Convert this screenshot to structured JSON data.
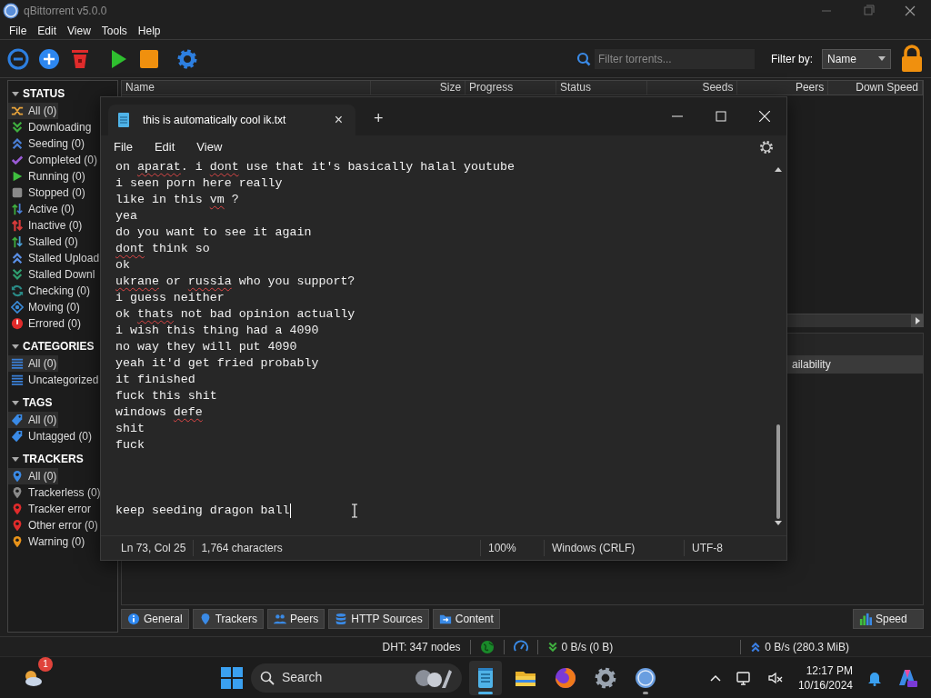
{
  "qbittorrent": {
    "title": "qBittorrent v5.0.0",
    "menu": [
      "File",
      "Edit",
      "View",
      "Tools",
      "Help"
    ],
    "search": {
      "placeholder": "Filter torrents..."
    },
    "filter_label": "Filter by:",
    "filter_value": "Name",
    "columns": [
      "Name",
      "Size",
      "Progress",
      "Status",
      "Seeds",
      "Peers",
      "Down Speed"
    ],
    "properties_header": "ailability",
    "sidebar": [
      {
        "title": "STATUS",
        "items": [
          {
            "label": "All (0)",
            "selected": true
          },
          {
            "label": "Downloading",
            "selected": false
          },
          {
            "label": "Seeding (0)",
            "selected": false
          },
          {
            "label": "Completed (0)",
            "selected": false
          },
          {
            "label": "Running (0)",
            "selected": false
          },
          {
            "label": "Stopped (0)",
            "selected": false
          },
          {
            "label": "Active (0)",
            "selected": false
          },
          {
            "label": "Inactive (0)",
            "selected": false
          },
          {
            "label": "Stalled (0)",
            "selected": false
          },
          {
            "label": "Stalled Upload",
            "selected": false
          },
          {
            "label": "Stalled Downl",
            "selected": false
          },
          {
            "label": "Checking (0)",
            "selected": false
          },
          {
            "label": "Moving (0)",
            "selected": false
          },
          {
            "label": "Errored (0)",
            "selected": false
          }
        ]
      },
      {
        "title": "CATEGORIES",
        "items": [
          {
            "label": "All (0)",
            "selected": true
          },
          {
            "label": "Uncategorized",
            "selected": false
          }
        ]
      },
      {
        "title": "TAGS",
        "items": [
          {
            "label": "All (0)",
            "selected": true
          },
          {
            "label": "Untagged (0)",
            "selected": false
          }
        ]
      },
      {
        "title": "TRACKERS",
        "items": [
          {
            "label": "All (0)",
            "selected": true
          },
          {
            "label": "Trackerless (0)",
            "selected": false
          },
          {
            "label": "Tracker error",
            "selected": false
          },
          {
            "label": "Other error (0)",
            "selected": false
          },
          {
            "label": "Warning (0)",
            "selected": false
          }
        ]
      }
    ],
    "bottom_tabs": [
      "General",
      "Trackers",
      "Peers",
      "HTTP Sources",
      "Content"
    ],
    "speed_button": "Speed",
    "status_bar": {
      "dht": "DHT: 347 nodes",
      "download": "0 B/s (0 B)",
      "upload": "0 B/s (280.3 MiB)"
    }
  },
  "notepad": {
    "tab_title": "this is automatically cool ik.txt",
    "tab_close": "×",
    "new_tab": "+",
    "menu": [
      "File",
      "Edit",
      "View"
    ],
    "lines": [
      {
        "parts": [
          {
            "text": "on ",
            "misspelled": false
          },
          {
            "text": "aparat",
            "misspelled": true
          },
          {
            "text": ". i ",
            "misspelled": false
          },
          {
            "text": "dont",
            "misspelled": true
          },
          {
            "text": " use that it's basically halal youtube",
            "misspelled": false
          }
        ]
      },
      {
        "parts": [
          {
            "text": "i seen porn here really",
            "misspelled": false
          }
        ]
      },
      {
        "parts": [
          {
            "text": "like in this ",
            "misspelled": false
          },
          {
            "text": "vm",
            "misspelled": true
          },
          {
            "text": " ?",
            "misspelled": false
          }
        ]
      },
      {
        "parts": [
          {
            "text": "yea",
            "misspelled": false
          }
        ]
      },
      {
        "parts": [
          {
            "text": "do you want to see it again",
            "misspelled": false
          }
        ]
      },
      {
        "parts": [
          {
            "text": "dont",
            "misspelled": true
          },
          {
            "text": " think so",
            "misspelled": false
          }
        ]
      },
      {
        "parts": [
          {
            "text": "ok",
            "misspelled": false
          }
        ]
      },
      {
        "parts": [
          {
            "text": "ukrane",
            "misspelled": true
          },
          {
            "text": " or ",
            "misspelled": false
          },
          {
            "text": "russia",
            "misspelled": true
          },
          {
            "text": " who you support?",
            "misspelled": false
          }
        ]
      },
      {
        "parts": [
          {
            "text": "i guess neither",
            "misspelled": false
          }
        ]
      },
      {
        "parts": [
          {
            "text": "ok ",
            "misspelled": false
          },
          {
            "text": "thats",
            "misspelled": true
          },
          {
            "text": " not bad opinion actually",
            "misspelled": false
          }
        ]
      },
      {
        "parts": [
          {
            "text": "i wish this thing had a 4090",
            "misspelled": false
          }
        ]
      },
      {
        "parts": [
          {
            "text": "no way they will put 4090",
            "misspelled": false
          }
        ]
      },
      {
        "parts": [
          {
            "text": "yeah it'd get fried probably",
            "misspelled": false
          }
        ]
      },
      {
        "parts": [
          {
            "text": "it finished",
            "misspelled": false
          }
        ]
      },
      {
        "parts": [
          {
            "text": "fuck this shit",
            "misspelled": false
          }
        ]
      },
      {
        "parts": [
          {
            "text": "windows ",
            "misspelled": false
          },
          {
            "text": "defe",
            "misspelled": true
          }
        ]
      },
      {
        "parts": [
          {
            "text": "shit",
            "misspelled": false
          }
        ]
      },
      {
        "parts": [
          {
            "text": "fuck",
            "misspelled": false
          }
        ]
      }
    ],
    "last_line": "keep seeding dragon ball",
    "status": [
      "Ln 73, Col 25",
      "1,764 characters",
      "100%",
      "Windows (CRLF)",
      "UTF-8"
    ]
  },
  "taskbar": {
    "notification_badge": "1",
    "search_label": "Search",
    "apps": [
      {
        "selected": true,
        "running": true
      },
      {
        "selected": false,
        "running": false
      },
      {
        "selected": false,
        "running": false
      },
      {
        "selected": false,
        "running": false
      },
      {
        "selected": false,
        "running": true
      }
    ],
    "time": "12:17 PM",
    "date": "10/16/2024"
  }
}
